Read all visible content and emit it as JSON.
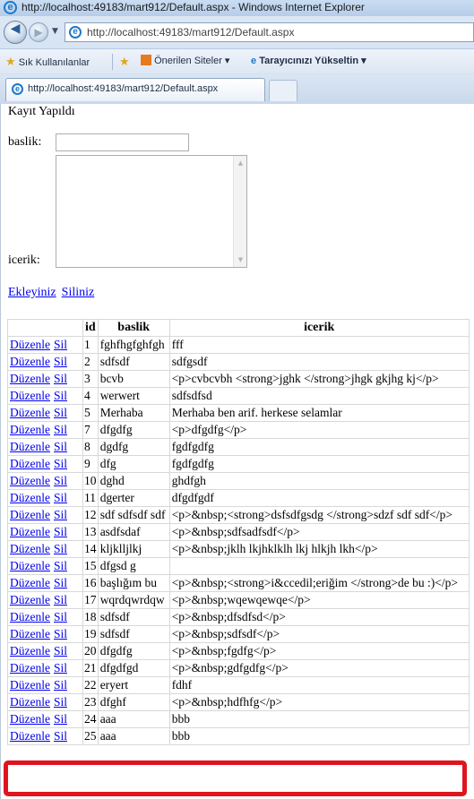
{
  "browser": {
    "title_bar": "http://localhost:49183/mart912/Default.aspx - Windows Internet Explorer",
    "address": "http://localhost:49183/mart912/Default.aspx",
    "favorites": {
      "label": "Sık Kullanılanlar",
      "suggested": "Önerilen Siteler ▾",
      "upgrade": "Tarayıcınızı Yükseltin ▾"
    },
    "tab_title": "http://localhost:49183/mart912/Default.aspx"
  },
  "page": {
    "status_message": "Kayıt Yapıldı",
    "form": {
      "baslik_label": "baslik:",
      "baslik_value": "",
      "icerik_label": "icerik:",
      "icerik_value": ""
    },
    "links": {
      "add": "Ekleyiniz",
      "delete": "Siliniz"
    },
    "grid": {
      "headers": {
        "action": "",
        "id": "id",
        "baslik": "baslik",
        "icerik": "icerik"
      },
      "edit_label": "Düzenle",
      "delete_label": "Sil",
      "rows": [
        {
          "id": "1",
          "baslik": "fghfhgfghfgh",
          "icerik": "fff"
        },
        {
          "id": "2",
          "baslik": "sdfsdf",
          "icerik": "sdfgsdf"
        },
        {
          "id": "3",
          "baslik": "bcvb",
          "icerik": "<p>cvbcvbh <strong>jghk </strong>jhgk gkjhg kj</p>"
        },
        {
          "id": "4",
          "baslik": "werwert",
          "icerik": "sdfsdfsd"
        },
        {
          "id": "5",
          "baslik": "Merhaba",
          "icerik": "Merhaba ben arif. herkese selamlar"
        },
        {
          "id": "7",
          "baslik": "dfgdfg",
          "icerik": "<p>dfgdfg</p>"
        },
        {
          "id": "8",
          "baslik": "dgdfg",
          "icerik": "fgdfgdfg"
        },
        {
          "id": "9",
          "baslik": "dfg",
          "icerik": "fgdfgdfg"
        },
        {
          "id": "10",
          "baslik": "dghd",
          "icerik": "ghdfgh"
        },
        {
          "id": "11",
          "baslik": "dgerter",
          "icerik": "dfgdfgdf"
        },
        {
          "id": "12",
          "baslik": "sdf sdfsdf sdf",
          "icerik": "<p>&nbsp;<strong>dsfsdfgsdg </strong>sdzf sdf sdf</p>"
        },
        {
          "id": "13",
          "baslik": "asdfsdaf",
          "icerik": "<p>&nbsp;sdfsadfsdf</p>"
        },
        {
          "id": "14",
          "baslik": "kljklljlkj",
          "icerik": "<p>&nbsp;jklh lkjhklklh lkj hlkjh lkh</p>"
        },
        {
          "id": "15",
          "baslik": "dfgsd g",
          "icerik": ""
        },
        {
          "id": "16",
          "baslik": "başlığım bu",
          "icerik": "<p>&nbsp;<strong>i&ccedil;eriğim </strong>de bu :)</p>"
        },
        {
          "id": "17",
          "baslik": "wqrdqwrdqw",
          "icerik": "<p>&nbsp;wqewqewqe</p>"
        },
        {
          "id": "18",
          "baslik": "sdfsdf",
          "icerik": "<p>&nbsp;dfsdfsd</p>"
        },
        {
          "id": "19",
          "baslik": "sdfsdf",
          "icerik": "<p>&nbsp;sdfsdf</p>"
        },
        {
          "id": "20",
          "baslik": "dfgdfg",
          "icerik": "<p>&nbsp;fgdfg</p>"
        },
        {
          "id": "21",
          "baslik": "dfgdfgd",
          "icerik": "<p>&nbsp;gdfgdfg</p>"
        },
        {
          "id": "22",
          "baslik": "eryert",
          "icerik": "fdhf"
        },
        {
          "id": "23",
          "baslik": "dfghf",
          "icerik": "<p>&nbsp;hdfhfg</p>"
        },
        {
          "id": "24",
          "baslik": "aaa",
          "icerik": "bbb"
        },
        {
          "id": "25",
          "baslik": "aaa",
          "icerik": "bbb"
        }
      ]
    }
  },
  "colors": {
    "link": "#0000ee",
    "highlight": "#e0141e"
  }
}
